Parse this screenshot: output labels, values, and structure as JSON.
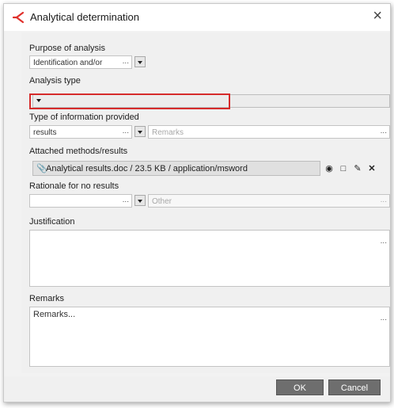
{
  "dialog": {
    "title": "Analytical determination",
    "close_glyph": "×"
  },
  "purpose": {
    "label": "Purpose of analysis",
    "value": "Identification and/or",
    "ellipsis": "..."
  },
  "analysis_type": {
    "label": "Analysis type",
    "value": ""
  },
  "info_type": {
    "label": "Type of information provided",
    "value": "results",
    "ellipsis": "...",
    "remarks_placeholder": "Remarks",
    "remarks_ellipsis": "..."
  },
  "attached": {
    "label": "Attached methods/results",
    "file": "Analytical results.doc / 23.5 KB / application/msword"
  },
  "rationale": {
    "label": "Rationale for no results",
    "value": "",
    "ellipsis": "...",
    "other_placeholder": "Other",
    "other_ellipsis": "..."
  },
  "justification": {
    "label": "Justification",
    "ellipsis": "..."
  },
  "remarks": {
    "label": "Remarks",
    "value": "Remarks...",
    "ellipsis": "..."
  },
  "footer": {
    "ok_label": "OK",
    "cancel_label": "Cancel"
  },
  "colors": {
    "highlight": "#d62b2b",
    "button_bg": "#6e6e6e",
    "brand_icon": "#e0302b"
  }
}
